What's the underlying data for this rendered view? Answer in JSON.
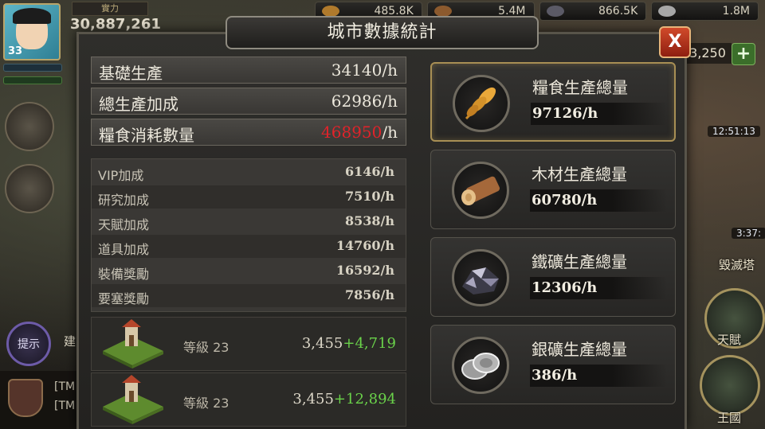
{
  "hud": {
    "power_label": "實力",
    "power_value": "30,887,261",
    "avatar_level": "33",
    "resources": [
      "485.8K",
      "5.4M",
      "866.5K",
      "1.8M"
    ],
    "gold_count": "3,250",
    "plus": "+",
    "timer_top": "12:51:13",
    "timer_mid": "3:37:",
    "destroy_tower": "毀滅塔",
    "talent": "天賦",
    "kingdom": "王國",
    "hint": "提示",
    "build": "建",
    "chat_lines": [
      "[TM",
      "[TM"
    ]
  },
  "dialog": {
    "title": "城市數據統計",
    "close": "X",
    "stats": [
      {
        "label": "基礎生產",
        "value": "34140",
        "unit": "/h",
        "red": false
      },
      {
        "label": "總生產加成",
        "value": "62986",
        "unit": "/h",
        "red": false
      },
      {
        "label": "糧食消耗數量",
        "value": "468950",
        "unit": "/h",
        "red": true
      }
    ],
    "bonuses": [
      {
        "label": "VIP加成",
        "value": "6146/h"
      },
      {
        "label": "研究加成",
        "value": "7510/h"
      },
      {
        "label": "天賦加成",
        "value": "8538/h"
      },
      {
        "label": "道具加成",
        "value": "14760/h"
      },
      {
        "label": "裝備獎勵",
        "value": "16592/h"
      },
      {
        "label": "要塞獎勵",
        "value": "7856/h"
      }
    ],
    "farms": [
      {
        "level": "等級 23",
        "base": "3,455",
        "bonus": "+4,719"
      },
      {
        "level": "等級 23",
        "base": "3,455",
        "bonus": "+12,894"
      }
    ],
    "resources": [
      {
        "name": "糧食生產總量",
        "value": "97126/h",
        "icon": "wheat-icon",
        "selected": true
      },
      {
        "name": "木材生產總量",
        "value": "60780/h",
        "icon": "wood-log-icon",
        "selected": false
      },
      {
        "name": "鐵礦生產總量",
        "value": "12306/h",
        "icon": "iron-ore-icon",
        "selected": false
      },
      {
        "name": "銀礦生產總量",
        "value": "386/h",
        "icon": "silver-coins-icon",
        "selected": false
      }
    ]
  }
}
